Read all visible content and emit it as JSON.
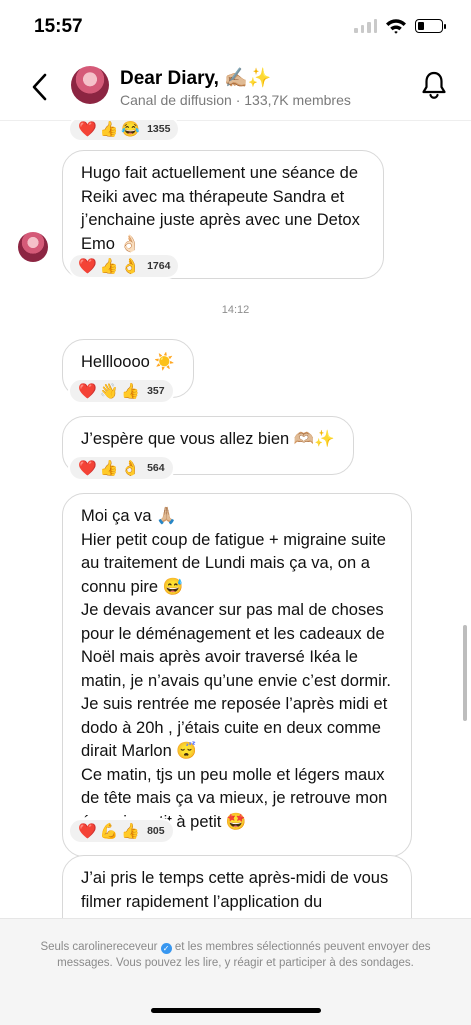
{
  "status_bar": {
    "time": "15:57"
  },
  "header": {
    "title": "Dear Diary, ✍🏼✨",
    "subtitle": "Canal de diffusion · 133,7K membres"
  },
  "icons": [
    "back-chevron-icon",
    "notification-bell-icon",
    "heart-emoji",
    "thumbs-up-emoji",
    "laughing-emoji",
    "ok-hand-emoji",
    "waving-hand-emoji",
    "flexed-biceps-emoji",
    "verified-badge-icon"
  ],
  "messages": [
    {
      "text": [],
      "reactions": [
        "❤️",
        "👍",
        "😂"
      ],
      "count": "1355"
    },
    {
      "text": [
        "Hugo fait actuellement une séance de Reiki avec ma thérapeute Sandra et j’enchaine juste après avec une Detox Emo 👌🏻"
      ],
      "reactions": [
        "❤️",
        "👍",
        "👌"
      ],
      "count": "1764"
    },
    {
      "text": [
        "Hellloooo ☀️"
      ],
      "reactions": [
        "❤️",
        "👋",
        "👍"
      ],
      "count": "357"
    },
    {
      "text": [
        "J’espère que vous allez bien 🫶🏼✨"
      ],
      "reactions": [
        "❤️",
        "👍",
        "👌"
      ],
      "count": "564"
    },
    {
      "text": [
        "Moi ça va 🙏🏼",
        "Hier petit coup de fatigue + migraine suite au traitement de Lundi mais ça va, on a connu pire 😅",
        "Je devais avancer sur pas mal de choses pour le déménagement et les cadeaux de Noël mais après avoir traversé Ikéa le matin, je n’avais qu’une envie c’est dormir. Je suis rentrée me reposée l’après midi et dodo à 20h , j’étais cuite en deux comme dirait Marlon 😴",
        "Ce matin, tjs un peu molle et légers maux de tête mais ça va mieux, je retrouve mon énergie petit à petit 🤩"
      ],
      "reactions": [
        "❤️",
        "💪",
        "👍"
      ],
      "count": "805"
    },
    {
      "text": [
        "J’ai pris le temps cette après-midi de vous filmer rapidement l’application du"
      ],
      "reactions": [],
      "count": ""
    }
  ],
  "timestamp": "14:12",
  "footer": {
    "before": "Seuls carolinereceveur",
    "after": "et les membres sélectionnés peuvent envoyer des messages. Vous pouvez les lire, y réagir et participer à des sondages."
  }
}
